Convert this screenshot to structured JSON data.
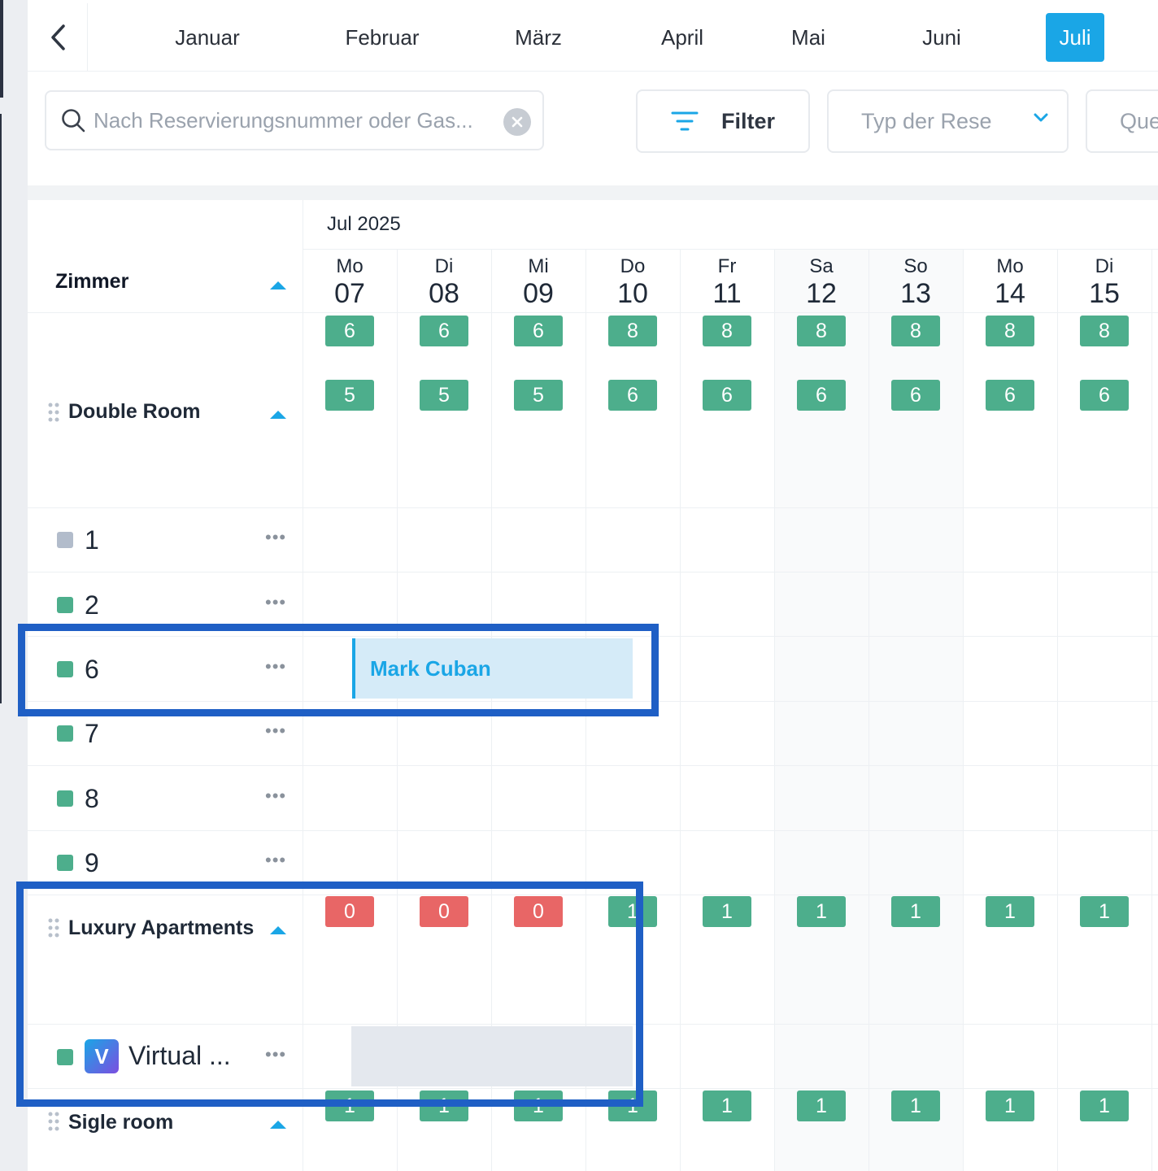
{
  "months": {
    "items": [
      "Januar",
      "Februar",
      "März",
      "April",
      "Mai",
      "Juni",
      "Juli"
    ],
    "active": "Juli"
  },
  "toolbar": {
    "search_placeholder": "Nach Reservierungsnummer oder Gas...",
    "filter_label": "Filter",
    "type_placeholder": "Typ der Rese",
    "cut_label": "Que"
  },
  "calendar": {
    "month_label": "Jul 2025",
    "rooms_header": "Zimmer",
    "days": [
      {
        "dow": "Mo",
        "num": "07"
      },
      {
        "dow": "Di",
        "num": "08"
      },
      {
        "dow": "Mi",
        "num": "09"
      },
      {
        "dow": "Do",
        "num": "10"
      },
      {
        "dow": "Fr",
        "num": "11"
      },
      {
        "dow": "Sa",
        "num": "12"
      },
      {
        "dow": "So",
        "num": "13"
      },
      {
        "dow": "Mo",
        "num": "14"
      },
      {
        "dow": "Di",
        "num": "15"
      }
    ],
    "total_availability": [
      "6",
      "6",
      "6",
      "8",
      "8",
      "8",
      "8",
      "8",
      "8"
    ]
  },
  "categories": {
    "double": {
      "name": "Double Room",
      "availability": [
        "5",
        "5",
        "5",
        "6",
        "6",
        "6",
        "6",
        "6",
        "6"
      ],
      "rooms": [
        "1",
        "2",
        "6",
        "7",
        "8",
        "9"
      ]
    },
    "luxury": {
      "name": "Luxury Apartments",
      "availability": [
        "0",
        "0",
        "0",
        "1",
        "1",
        "1",
        "1",
        "1",
        "1"
      ],
      "rooms": [
        "Virtual ..."
      ],
      "logo_letter": "V"
    },
    "single": {
      "name": "Sigle room",
      "availability": [
        "1",
        "1",
        "1",
        "1",
        "1",
        "1",
        "1",
        "1",
        "1"
      ]
    }
  },
  "booking": {
    "guest": "Mark Cuban"
  },
  "icons": {
    "back": "chevron-left-icon",
    "search": "search-icon",
    "clear": "clear-icon",
    "filter": "filter-icon",
    "dropdown": "chevron-down-icon",
    "grip": "drag-handle-icon",
    "more": "more-icon"
  },
  "colors": {
    "accent": "#1aa6e6",
    "available": "#4dae8c",
    "unavailable": "#e86666",
    "highlight": "#1f5fc5"
  }
}
